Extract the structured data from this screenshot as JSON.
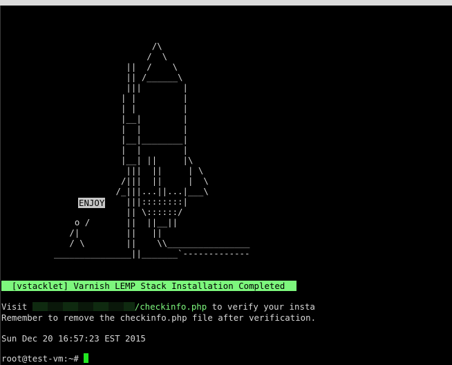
{
  "terminal": {
    "ascii_art": "                   /\\\n                  /  \\\n              ||  /    \\\n              || /______\\\n              |||        |\n             | |         |\n             | |         |\n             |__|        |\n             |  |        |\n             |__|________|\n             |  |        |\n             |__| ||     |\\\n              |||  ||     | \\\n             /|||  ||     |  \\\n            /_|||...||...|___\\\n              |||::::::::|\n              || \\::::::/\n    o /       ||  ||__||\n   /|         ||   ||\n   / \\        ||    \\\\________________\n_______________||_______`-------------",
    "enjoy_label": "ENJOY",
    "banner": "  [vstacklet] Varnish LEMP Stack Installation Completed",
    "visit_prefix": "Visit ",
    "visit_link": "/checkinfo.php",
    "visit_suffix": " to verify your insta",
    "reminder": "Remember to remove the checkinfo.php file after verification.",
    "timestamp": "Sun Dec 20 16:57:23 EST 2015",
    "prompt": "root@test-vm:~# "
  },
  "colors": {
    "background": "#000000",
    "foreground": "#d8d8d8",
    "banner_bg": "#7df77d",
    "link": "#7df77d",
    "cursor": "#22e622"
  }
}
